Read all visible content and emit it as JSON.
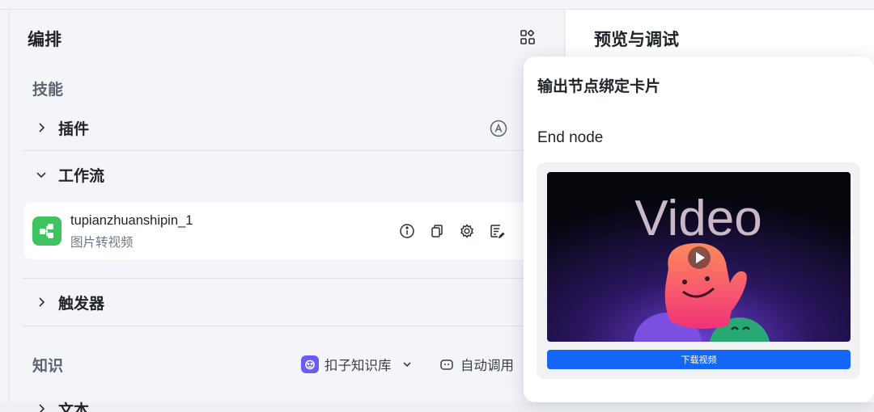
{
  "left_panel": {
    "title": "编排",
    "skills_label": "技能",
    "plugins_label": "插件",
    "workflow_label": "工作流",
    "workflow_item": {
      "name": "tupianzhuanshipin_1",
      "desc": "图片转视频"
    },
    "trigger_label": "触发器",
    "knowledge_label": "知识",
    "knowledge_base_label": "扣子知识库",
    "auto_call_label": "自动调用",
    "text_label": "文本"
  },
  "right_panel": {
    "title": "预览与调试"
  },
  "popover": {
    "title": "输出节点绑定卡片",
    "node_label": "End node",
    "video_thumb_text": "Video",
    "download_label": "下载视频"
  },
  "colors": {
    "accent": "#1467f5",
    "workflow_logo": "#3ec35f",
    "kb_icon": "#6b5cf6"
  }
}
